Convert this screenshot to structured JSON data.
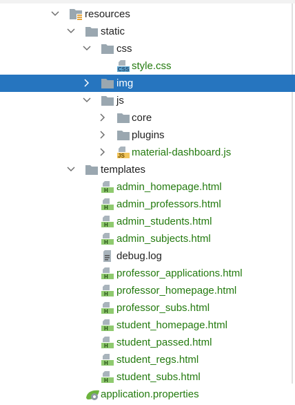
{
  "tree": {
    "resources": "resources",
    "static": "static",
    "css": "css",
    "style_css": "style.css",
    "img": "img",
    "js": "js",
    "core": "core",
    "plugins": "plugins",
    "material_dashboard": "material-dashboard.js",
    "templates": "templates",
    "template_files": [
      "admin_homepage.html",
      "admin_professors.html",
      "admin_students.html",
      "admin_subjects.html",
      "debug.log",
      "professor_applications.html",
      "professor_homepage.html",
      "professor_subs.html",
      "student_homepage.html",
      "student_passed.html",
      "student_regs.html",
      "student_subs.html"
    ],
    "application_properties": "application.properties"
  },
  "colors": {
    "selection": "#2675bf",
    "vcs_added": "#237a0e",
    "folder": "#9aa7b0"
  }
}
